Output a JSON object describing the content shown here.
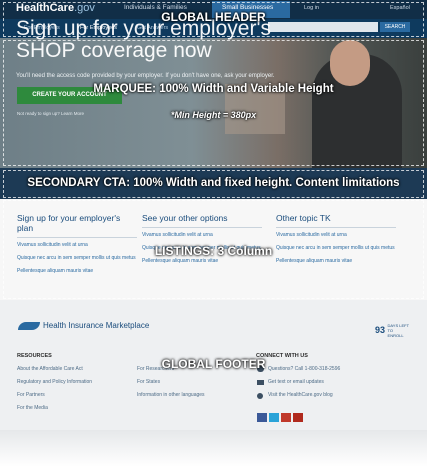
{
  "header": {
    "logo_main": "HealthCare",
    "logo_suffix": ".gov",
    "nav_individuals": "Individuals & Families",
    "nav_small_business": "Small Businesses",
    "login": "Log in",
    "espanol": "Español",
    "sub_employers": "For Employers",
    "sub_employees": "For Employees",
    "sub_answers": "Get Answers",
    "search_placeholder": "",
    "search_button": "SEARCH"
  },
  "marquee": {
    "title_line1": "Sign up for your employer's",
    "title_line2": "SHOP coverage now",
    "subtitle": "You'll need the access code provided by your employer. If you don't have one, ask your employer.",
    "cta_label": "CREATE YOUR ACCOUNT",
    "note": "Not ready to sign up? Learn More"
  },
  "listings": {
    "columns": [
      {
        "heading": "Sign up for your employer's plan",
        "links": [
          "Vivamus sollicitudin velit at urna",
          "Quisque nec arcu in sem semper mollis ut quis metus",
          "Pellentesque aliquam mauris vitae"
        ]
      },
      {
        "heading": "See your other options",
        "links": [
          "Vivamus sollicitudin velit at urna",
          "Quisque nec arcu in sem semper mollis ut quis metus",
          "Pellentesque aliquam mauris vitae"
        ]
      },
      {
        "heading": "Other topic TK",
        "links": [
          "Vivamus sollicitudin velit at urna",
          "Quisque nec arcu in sem semper mollis ut quis metus",
          "Pellentesque aliquam mauris vitae"
        ]
      }
    ]
  },
  "footer": {
    "logo_text": "Health Insurance Marketplace",
    "seal_number": "93",
    "seal_text": "DAYS LEFT TO ENROLL",
    "resources_heading": "RESOURCES",
    "resources_links": [
      "About the Affordable Care Act",
      "Regulatory and Policy Information",
      "For Partners",
      "For the Media"
    ],
    "col2_links": [
      "For Researchers",
      "For States",
      "Information in other languages"
    ],
    "connect_heading": "CONNECT WITH US",
    "connect_phone": "Questions? Call 1-800-318-2596",
    "connect_email": "Get text or email updates",
    "connect_blog": "Visit the HealthCare.gov blog",
    "social": [
      "f",
      "t",
      "g+",
      "yt"
    ]
  },
  "annotations": {
    "global_header": "GLOBAL HEADER",
    "marquee": "MARQUEE: 100% Width and Variable Height",
    "marquee_height": "*Min Height = 380px",
    "secondary_cta": "SECONDARY CTA: 100% Width and fixed height. Content limitations",
    "listings": "LISTINGS: 3 Column",
    "global_footer": "GLOBAL FOOTER"
  },
  "colors": {
    "header_bg": "#0b2d4a",
    "accent_blue": "#2a6aa1",
    "cta_green": "#2e8a3d"
  }
}
